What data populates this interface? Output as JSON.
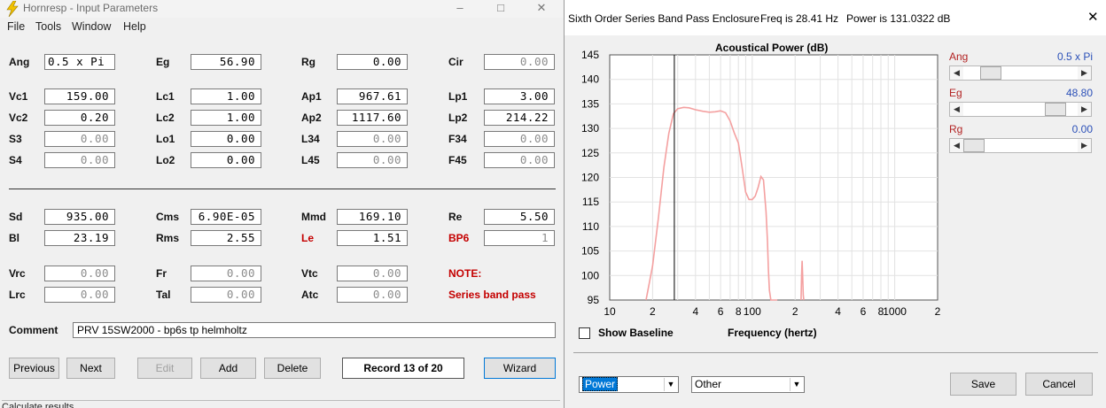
{
  "left": {
    "title": "Hornresp - Input Parameters",
    "menu": [
      "File",
      "Tools",
      "Window",
      "Help"
    ],
    "rows": [
      [
        {
          "label": "Ang",
          "value": "0.5 x Pi",
          "align": "left"
        },
        {
          "label": "Eg",
          "value": "56.90"
        },
        {
          "label": "Rg",
          "value": "0.00"
        },
        {
          "label": "Cir",
          "value": "0.00",
          "dim": true
        }
      ],
      [
        {
          "label": "Vc1",
          "value": "159.00"
        },
        {
          "label": "Lc1",
          "value": "1.00"
        },
        {
          "label": "Ap1",
          "value": "967.61"
        },
        {
          "label": "Lp1",
          "value": "3.00"
        }
      ],
      [
        {
          "label": "Vc2",
          "value": "0.20"
        },
        {
          "label": "Lc2",
          "value": "1.00"
        },
        {
          "label": "Ap2",
          "value": "1117.60"
        },
        {
          "label": "Lp2",
          "value": "214.22"
        }
      ],
      [
        {
          "label": "S3",
          "value": "0.00",
          "dim": true
        },
        {
          "label": "Lo1",
          "value": "0.00"
        },
        {
          "label": "L34",
          "value": "0.00",
          "dim": true
        },
        {
          "label": "F34",
          "value": "0.00",
          "dim": true
        }
      ],
      [
        {
          "label": "S4",
          "value": "0.00",
          "dim": true
        },
        {
          "label": "Lo2",
          "value": "0.00"
        },
        {
          "label": "L45",
          "value": "0.00",
          "dim": true
        },
        {
          "label": "F45",
          "value": "0.00",
          "dim": true
        }
      ],
      [
        {
          "label": "Sd",
          "value": "935.00"
        },
        {
          "label": "Cms",
          "value": "6.90E-05"
        },
        {
          "label": "Mmd",
          "value": "169.10"
        },
        {
          "label": "Re",
          "value": "5.50"
        }
      ],
      [
        {
          "label": "Bl",
          "value": "23.19"
        },
        {
          "label": "Rms",
          "value": "2.55"
        },
        {
          "label": "Le",
          "value": "1.51",
          "red": true
        },
        {
          "label": "BP6",
          "value": "1",
          "red": true,
          "dim": true
        }
      ],
      [
        {
          "label": "Vrc",
          "value": "0.00",
          "dim": true
        },
        {
          "label": "Fr",
          "value": "0.00",
          "dim": true
        },
        {
          "label": "Vtc",
          "value": "0.00",
          "dim": true
        },
        {
          "label": "NOTE:",
          "red": true,
          "nofield": true
        }
      ],
      [
        {
          "label": "Lrc",
          "value": "0.00",
          "dim": true
        },
        {
          "label": "Tal",
          "value": "0.00",
          "dim": true
        },
        {
          "label": "Atc",
          "value": "0.00",
          "dim": true
        },
        {
          "label": "Series band pass",
          "red": true,
          "nofield": true
        }
      ]
    ],
    "comment_label": "Comment",
    "comment_value": "PRV 15SW2000 - bp6s tp helmholtz",
    "buttons": {
      "previous": "Previous",
      "next": "Next",
      "edit": "Edit",
      "add": "Add",
      "delete": "Delete",
      "record": "Record 13 of 20",
      "wizard": "Wizard"
    },
    "status": "Calculate results"
  },
  "right": {
    "title": "Sixth Order Series Band Pass Enclosure",
    "freq": "Freq is 28.41 Hz",
    "power": "Power is 131.0322 dB",
    "sliders": [
      {
        "label": "Ang",
        "value": "0.5 x Pi",
        "level": 0.18
      },
      {
        "label": "Eg",
        "value": "48.80",
        "level": 0.88
      },
      {
        "label": "Rg",
        "value": "0.00",
        "level": 0.0
      }
    ],
    "show_baseline": "Show Baseline",
    "xlabel": "Frequency (hertz)",
    "combo1": "Power",
    "combo2": "Other",
    "save": "Save",
    "cancel": "Cancel"
  },
  "chart_data": {
    "type": "line",
    "title": "Acoustical Power (dB)",
    "xlabel": "Frequency (hertz)",
    "ylabel": "",
    "xscale": "log",
    "xlim": [
      10,
      2000
    ],
    "ylim": [
      95,
      145
    ],
    "yticks": [
      95,
      100,
      105,
      110,
      115,
      120,
      125,
      130,
      135,
      140,
      145
    ],
    "xtick_labels": [
      "10",
      "2",
      "4",
      "6",
      "8",
      "100",
      "2",
      "4",
      "6",
      "8",
      "1000",
      "2"
    ],
    "cursor_x": 28.41,
    "grid": true,
    "series": [
      {
        "color": "#f4a0a0",
        "x": [
          18,
          20,
          22,
          24,
          26,
          28,
          30,
          33,
          36,
          40,
          45,
          50,
          55,
          60,
          65,
          70,
          75,
          80,
          85,
          90,
          95,
          100,
          105,
          110,
          115,
          120,
          125,
          128,
          130,
          132,
          135,
          140,
          145,
          148,
          150
        ],
        "y": [
          95,
          102,
          112,
          122,
          129,
          133,
          134,
          134.3,
          134.2,
          133.8,
          133.5,
          133.3,
          133.4,
          133.6,
          133.2,
          131.5,
          129,
          127,
          122,
          117,
          115.5,
          115.5,
          116.2,
          118,
          120.2,
          119.5,
          113,
          107,
          101,
          97,
          95,
          95,
          95,
          95,
          95
        ]
      },
      {
        "color": "#f4a0a0",
        "x": [
          220,
          222,
          224,
          226,
          228,
          230
        ],
        "y": [
          95,
          100,
          103,
          100,
          96,
          95
        ]
      }
    ]
  }
}
